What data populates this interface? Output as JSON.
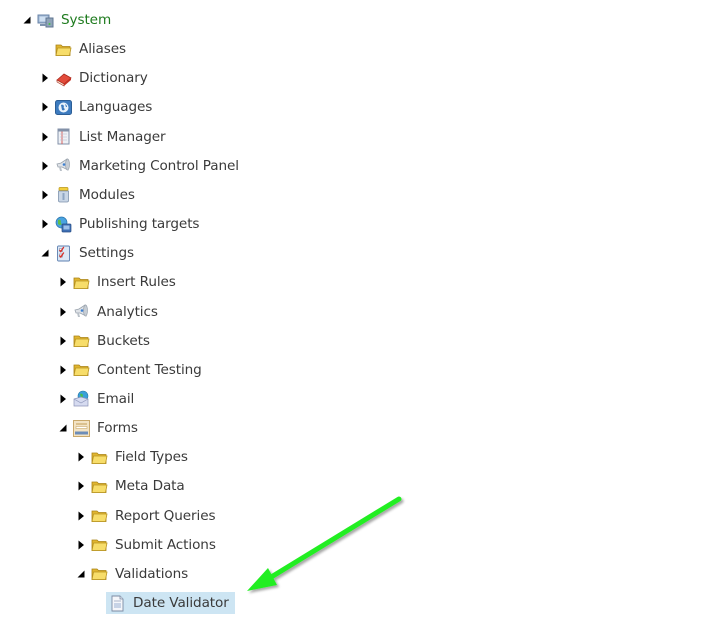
{
  "tree": {
    "items": [
      {
        "label": "System",
        "level": 0,
        "state": "expanded",
        "icon": "system-computer-icon",
        "root": true
      },
      {
        "label": "Aliases",
        "level": 1,
        "state": "leaf",
        "icon": "folder-icon"
      },
      {
        "label": "Dictionary",
        "level": 1,
        "state": "collapsed",
        "icon": "dictionary-book-icon"
      },
      {
        "label": "Languages",
        "level": 1,
        "state": "collapsed",
        "icon": "globe-icon"
      },
      {
        "label": "List Manager",
        "level": 1,
        "state": "collapsed",
        "icon": "list-manager-icon"
      },
      {
        "label": "Marketing Control Panel",
        "level": 1,
        "state": "collapsed",
        "icon": "megaphone-icon"
      },
      {
        "label": "Modules",
        "level": 1,
        "state": "collapsed",
        "icon": "modules-jar-icon"
      },
      {
        "label": "Publishing targets",
        "level": 1,
        "state": "collapsed",
        "icon": "publishing-globe-icon"
      },
      {
        "label": "Settings",
        "level": 1,
        "state": "expanded",
        "icon": "settings-checklist-icon"
      },
      {
        "label": "Insert Rules",
        "level": 2,
        "state": "collapsed",
        "icon": "folder-icon"
      },
      {
        "label": "Analytics",
        "level": 2,
        "state": "collapsed",
        "icon": "megaphone-icon"
      },
      {
        "label": "Buckets",
        "level": 2,
        "state": "collapsed",
        "icon": "folder-icon"
      },
      {
        "label": "Content Testing",
        "level": 2,
        "state": "collapsed",
        "icon": "folder-icon"
      },
      {
        "label": "Email",
        "level": 2,
        "state": "collapsed",
        "icon": "email-globe-icon"
      },
      {
        "label": "Forms",
        "level": 2,
        "state": "expanded",
        "icon": "forms-icon"
      },
      {
        "label": "Field Types",
        "level": 3,
        "state": "collapsed",
        "icon": "folder-icon"
      },
      {
        "label": "Meta Data",
        "level": 3,
        "state": "collapsed",
        "icon": "folder-icon"
      },
      {
        "label": "Report Queries",
        "level": 3,
        "state": "collapsed",
        "icon": "folder-icon"
      },
      {
        "label": "Submit Actions",
        "level": 3,
        "state": "collapsed",
        "icon": "folder-icon"
      },
      {
        "label": "Validations",
        "level": 3,
        "state": "expanded",
        "icon": "folder-icon"
      },
      {
        "label": "Date Validator",
        "level": 4,
        "state": "leaf",
        "icon": "document-icon",
        "selected": true
      }
    ]
  },
  "annotation": {
    "type": "arrow",
    "color": "#22ee22",
    "points_to": "Date Validator"
  }
}
